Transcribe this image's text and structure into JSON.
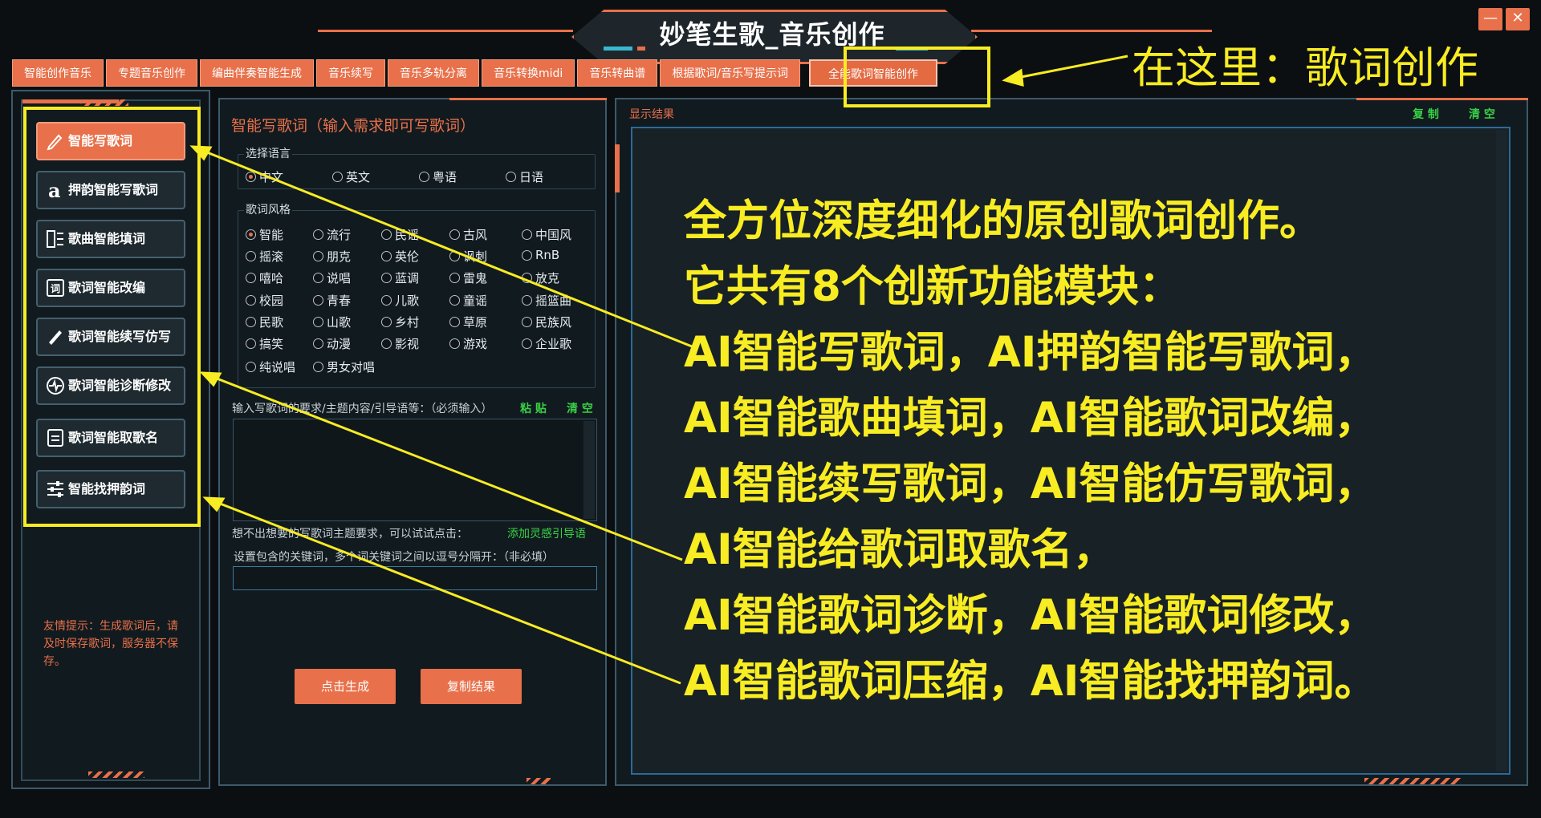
{
  "app": {
    "title": "妙笔生歌_音乐创作"
  },
  "window_controls": {
    "minimize": "—",
    "close": "✕"
  },
  "tabs": [
    "智能创作音乐",
    "专题音乐创作",
    "编曲伴奏智能生成",
    "音乐续写",
    "音乐多轨分离",
    "音乐转换midi",
    "音乐转曲谱",
    "根据歌词/音乐写提示词",
    "全能歌词智能创作"
  ],
  "sidebar": {
    "items": [
      {
        "label": "智能写歌词",
        "icon": "pen-icon"
      },
      {
        "label": "押韵智能写歌词",
        "icon": "rhyme-a-icon"
      },
      {
        "label": "歌曲智能填词",
        "icon": "lines-icon"
      },
      {
        "label": "歌词智能改编",
        "icon": "lyric-edit-icon"
      },
      {
        "label": "歌词智能续写仿写",
        "icon": "pencil-icon"
      },
      {
        "label": "歌词智能诊断修改",
        "icon": "pulse-icon"
      },
      {
        "label": "歌词智能取歌名",
        "icon": "name-icon"
      },
      {
        "label": "智能找押韵词",
        "icon": "sliders-icon"
      }
    ],
    "tip": "友情提示：生成歌词后，请及时保存歌词，服务器不保存。"
  },
  "form": {
    "title": "智能写歌词（输入需求即可写歌词）",
    "language_label": "选择语言",
    "languages": [
      "中文",
      "英文",
      "粤语",
      "日语"
    ],
    "selected_language": "中文",
    "style_label": "歌词风格",
    "styles": [
      "智能",
      "流行",
      "民谣",
      "古风",
      "中国风",
      "摇滚",
      "朋克",
      "英伦",
      "讽刺",
      "RnB",
      "嘻哈",
      "说唱",
      "蓝调",
      "雷鬼",
      "放克",
      "校园",
      "青春",
      "儿歌",
      "童谣",
      "摇篮曲",
      "民歌",
      "山歌",
      "乡村",
      "草原",
      "民族风",
      "搞笑",
      "动漫",
      "影视",
      "游戏",
      "企业歌",
      "纯说唱",
      "男女对唱"
    ],
    "selected_style": "智能",
    "requirement_label": "输入写歌词的要求/主题内容/引导语等：（必须输入）",
    "paste": "粘 贴",
    "clear": "清 空",
    "requirement_value": "",
    "hint_label": "想不出想要的写歌词主题要求，可以试试点击：",
    "add_inspiration": "添加灵感引导语",
    "keywords_label": "设置包含的关键词，多个词关键词之间以逗号分隔开：（非必填）",
    "keywords_value": "",
    "generate_button": "点击生成",
    "copy_result_button": "复制结果"
  },
  "result": {
    "title": "显示结果",
    "copy": "复 制",
    "clear": "清 空",
    "lines": [
      "全方位深度细化的原创歌词创作。",
      "它共有8个创新功能模块：",
      "AI智能写歌词，AI押韵智能写歌词，",
      "AI智能歌曲填词，AI智能歌词改编，",
      "AI智能续写歌词，AI智能仿写歌词，",
      "AI智能给歌词取歌名，",
      "AI智能歌词诊断，AI智能歌词修改，",
      "AI智能歌词压缩，AI智能找押韵词。"
    ]
  },
  "annotation": {
    "label": "在这里：歌词创作"
  },
  "colors": {
    "accent": "#e8704a",
    "annotation": "#f8ec22",
    "green": "#39d046",
    "background": "#111a1f"
  }
}
